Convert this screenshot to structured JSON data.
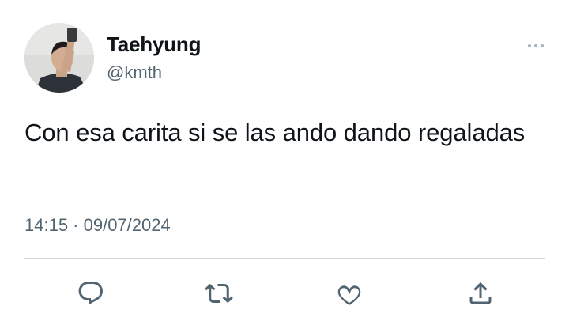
{
  "tweet": {
    "author": {
      "display_name": "Taehyung",
      "handle": "@kmth",
      "avatar_icon": "user-avatar-photo"
    },
    "text": "Con esa carita si se las ando dando regaladas",
    "timestamp": "14:15 · 09/07/2024",
    "more_icon": "more-horizontal-icon",
    "actions": [
      {
        "name": "reply",
        "icon": "reply-icon"
      },
      {
        "name": "retweet",
        "icon": "retweet-icon"
      },
      {
        "name": "like",
        "icon": "heart-icon"
      },
      {
        "name": "share",
        "icon": "share-icon"
      }
    ]
  },
  "colors": {
    "text_primary": "#0f1419",
    "text_secondary": "#536471",
    "divider": "#cfd9de",
    "icon": "#536471"
  }
}
